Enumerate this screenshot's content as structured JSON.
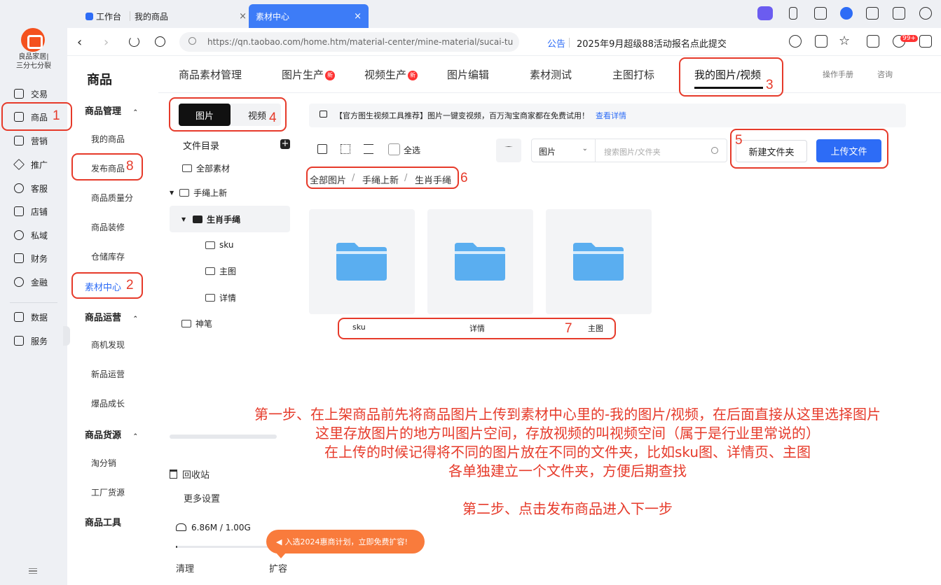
{
  "shop": {
    "name_line1": "良品家居|",
    "name_line2": "三分七分裂"
  },
  "rail": {
    "items": [
      {
        "label": "交易",
        "icon": "receipt-icon"
      },
      {
        "label": "商品",
        "icon": "product-icon"
      },
      {
        "label": "营销",
        "icon": "marketing-icon"
      },
      {
        "label": "推广",
        "icon": "send-icon"
      },
      {
        "label": "客服",
        "icon": "service-icon"
      },
      {
        "label": "店铺",
        "icon": "store-icon"
      },
      {
        "label": "私域",
        "icon": "users-icon"
      },
      {
        "label": "财务",
        "icon": "finance-icon"
      },
      {
        "label": "金融",
        "icon": "loan-icon"
      },
      {
        "label": "数据",
        "icon": "chart-icon"
      },
      {
        "label": "服务",
        "icon": "service-box-icon"
      }
    ]
  },
  "tabs": [
    {
      "label": "工作台"
    },
    {
      "label": "我的商品"
    },
    {
      "label": "素材中心"
    }
  ],
  "tab_close": "×",
  "address": {
    "url": "https://qn.taobao.com/home.htm/material-center/mine-material/sucai-tu",
    "notice_label": "公告",
    "notice_text": "2025年9月超级88活动报名点此提交",
    "badge": "99+"
  },
  "sidebar": {
    "title": "商品",
    "groups": [
      {
        "label": "商品管理",
        "items": [
          "我的商品",
          "发布商品",
          "商品质量分",
          "商品装修",
          "仓储库存",
          "素材中心"
        ]
      },
      {
        "label": "商品运营",
        "items": [
          "商机发现",
          "新品运营",
          "爆品成长"
        ]
      },
      {
        "label": "商品货源",
        "items": [
          "淘分销",
          "工厂货源"
        ]
      },
      {
        "label": "商品工具",
        "items": []
      }
    ],
    "caret": "⌃"
  },
  "top_nav": {
    "items": [
      "商品素材管理",
      "图片生产",
      "视频生产",
      "图片编辑",
      "素材测试",
      "主图打标",
      "我的图片/视频"
    ],
    "new_badge": "新",
    "manual": "操作手册",
    "consult": "咨询"
  },
  "media_switch": {
    "image": "图片",
    "video": "视频"
  },
  "tree": {
    "header": "文件目录",
    "add": "+",
    "all": "全部素材",
    "folders": [
      "手绳上新",
      "生肖手绳",
      "sku",
      "主图",
      "详情",
      "神笔"
    ]
  },
  "promo": {
    "text": "【官方图生视频工具推荐】图片一键变视频，百万淘宝商家都在免费试用！",
    "link": "查看详情"
  },
  "toolbar": {
    "select_all": "全选",
    "type_value": "图片",
    "search_placeholder": "搜索图片/文件夹",
    "new_folder": "新建文件夹",
    "upload": "上传文件"
  },
  "breadcrumb": [
    "全部图片",
    "手绳上新",
    "生肖手绳"
  ],
  "breadcrumb_sep": "/",
  "cards": [
    {
      "label": "sku"
    },
    {
      "label": "详情"
    },
    {
      "label": "主图"
    }
  ],
  "bottom": {
    "recycle": "回收站",
    "more": "更多设置",
    "storage": "6.86M / 1.00G",
    "storage_used_fraction": 0.007,
    "clean": "清理",
    "expand": "扩容",
    "bubble": "入选2024惠商计划，立即免费扩容!"
  },
  "annotations": {
    "numbers": [
      "1",
      "2",
      "3",
      "4",
      "5",
      "6",
      "7",
      "8"
    ],
    "notes": [
      "第一步、在上架商品前先将商品图片上传到素材中心里的-我的图片/视频，在后面直接从这里选择图片",
      "这里存放图片的地方叫图片空间，存放视频的叫视频空间（属于是行业里常说的）",
      "在上传的时候记得将不同的图片放在不同的文件夹，比如sku图、详情页、主图",
      "各单独建立一个文件夹，方便后期查找",
      "第二步、点击发布商品进入下一步"
    ],
    "color": "#e63a2a"
  },
  "colors": {
    "accent": "#2d6cf6",
    "folder": "#5aaef0",
    "promo_orange": "#f97b3c"
  }
}
